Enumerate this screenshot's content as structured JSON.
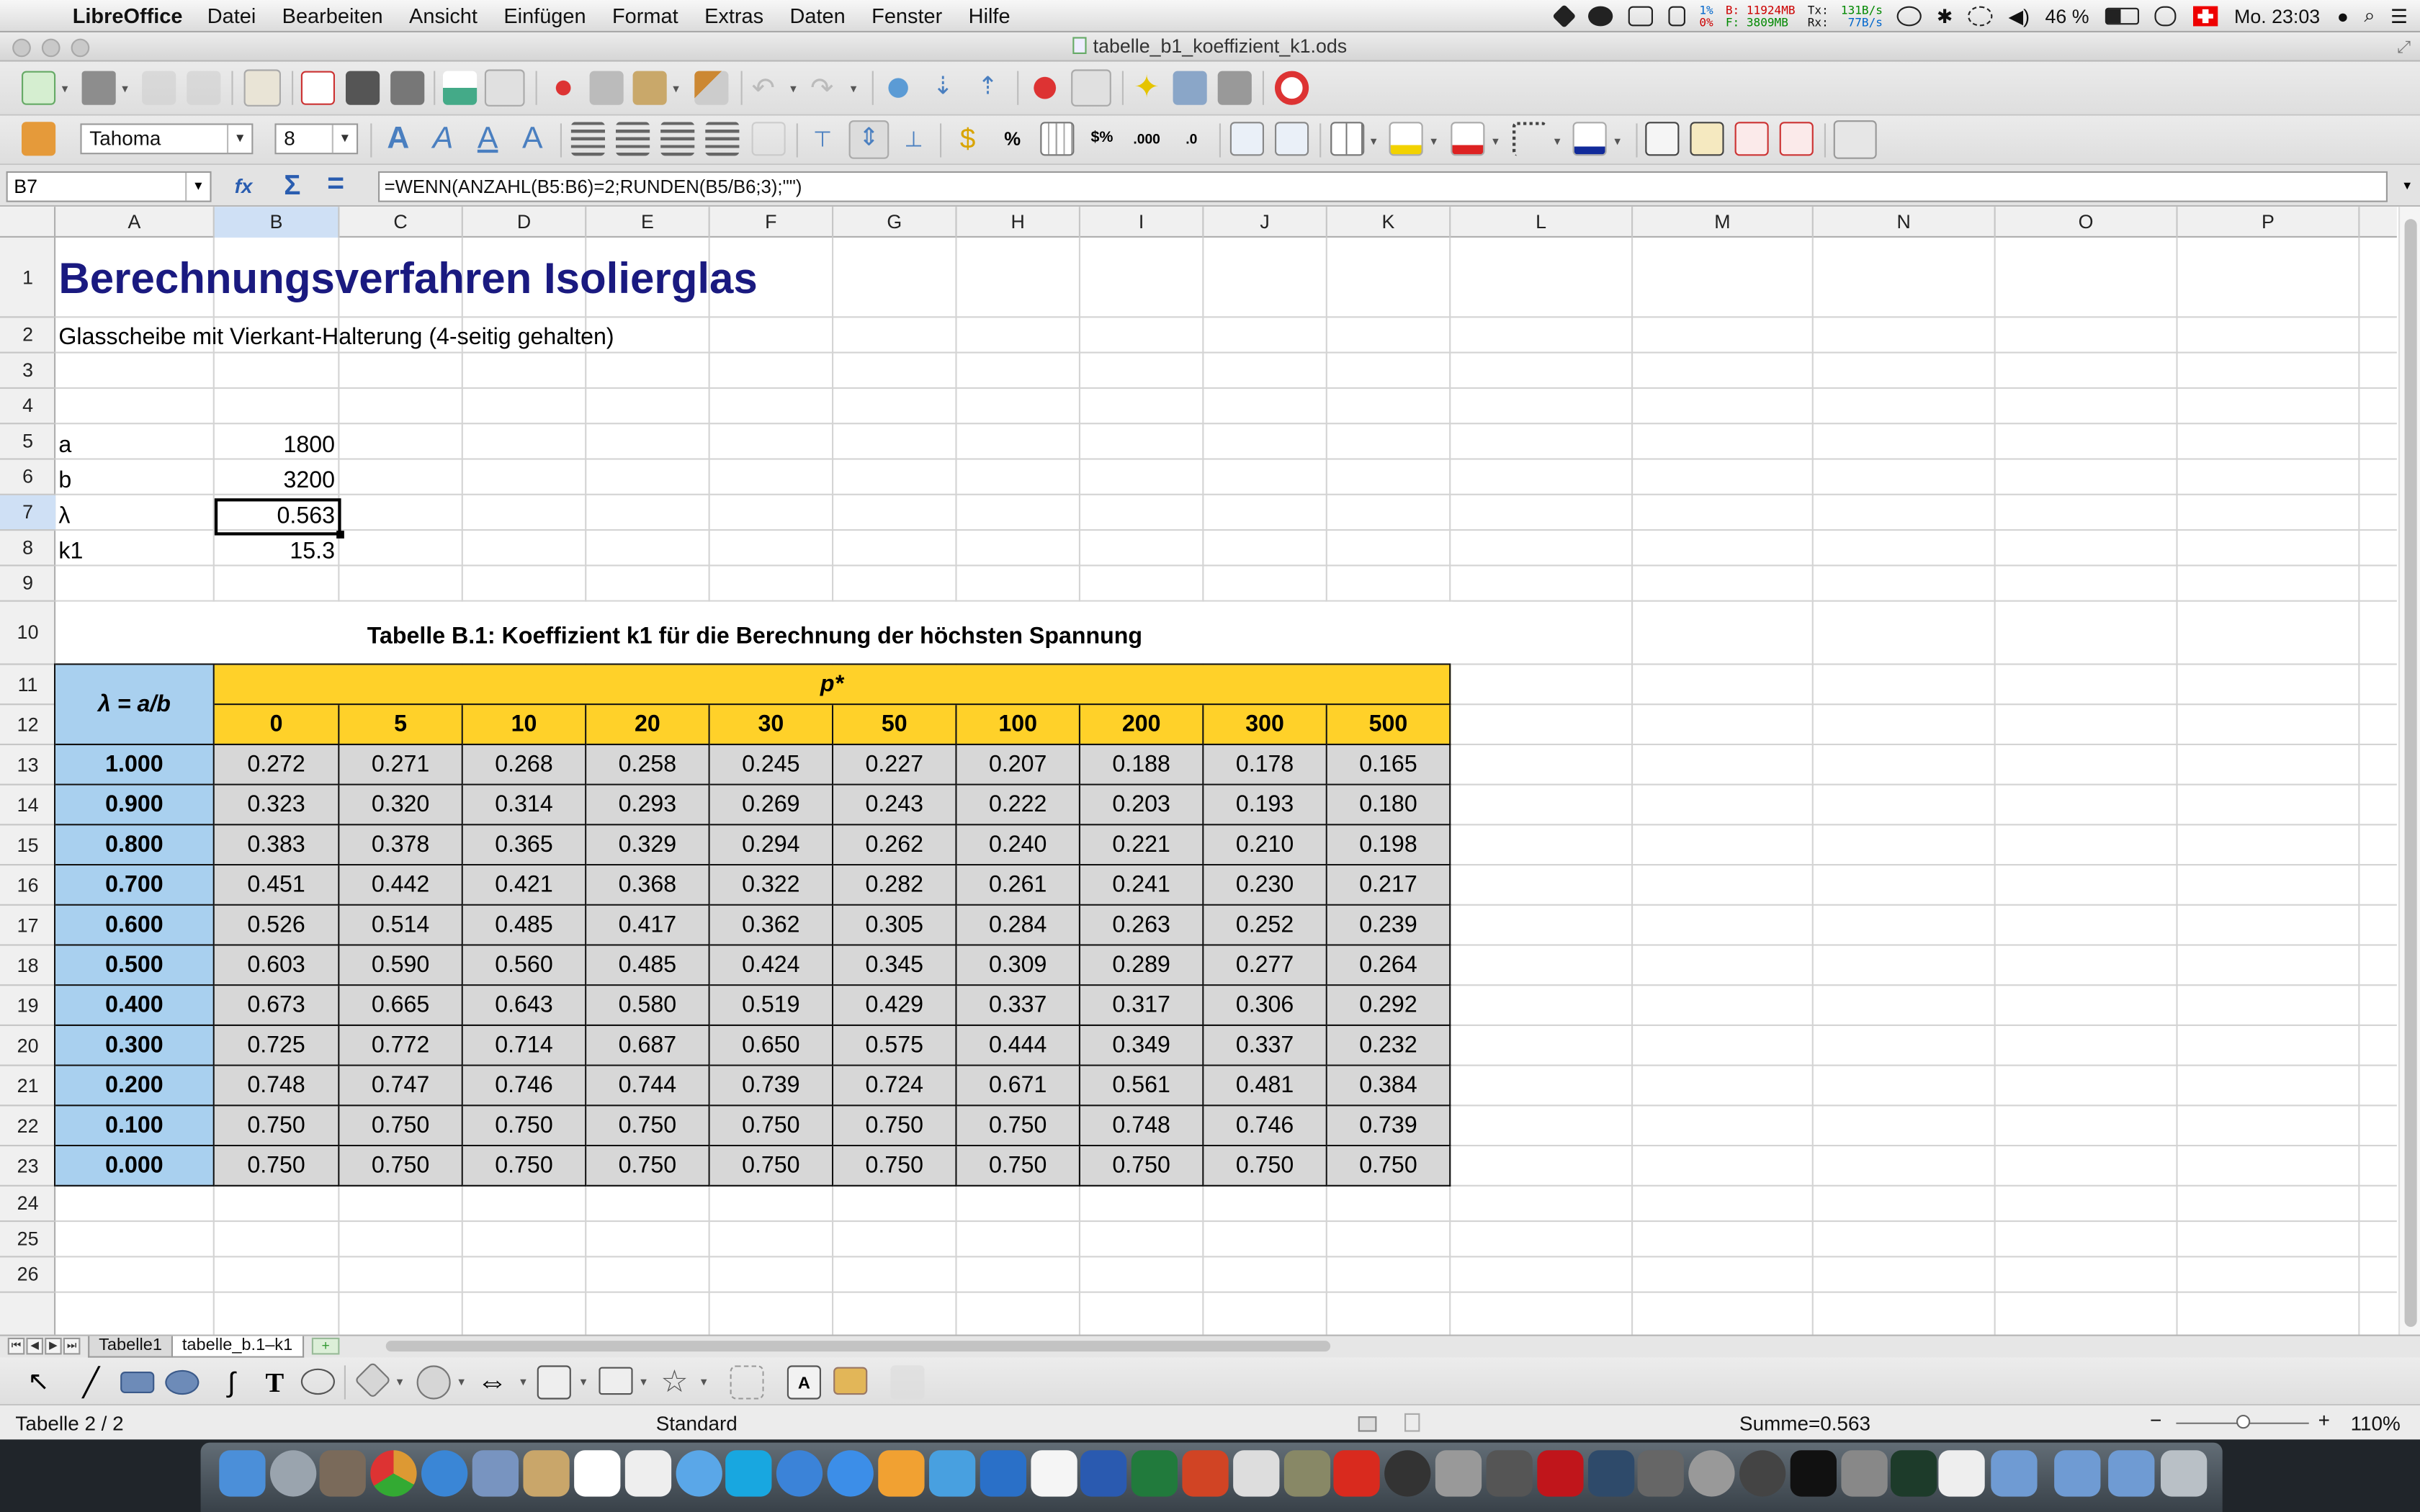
{
  "menubar": {
    "app": "LibreOffice",
    "items": [
      "Datei",
      "Bearbeiten",
      "Ansicht",
      "Einfügen",
      "Format",
      "Extras",
      "Daten",
      "Fenster",
      "Hilfe"
    ],
    "cpu": [
      "1%",
      "0%"
    ],
    "mem": [
      "B: 11924MB",
      "F:  3809MB"
    ],
    "net_labels": [
      "Tx:",
      "Rx:"
    ],
    "net_values": [
      "131B/s",
      "77B/s"
    ],
    "battery": "46 %",
    "clock": "Mo. 23:03"
  },
  "window": {
    "title": "tabelle_b1_koeffizient_k1.ods"
  },
  "format_toolbar": {
    "font_name": "Tahoma",
    "font_size": "8"
  },
  "formula_bar": {
    "cell_ref": "B7",
    "formula": "=WENN(ANZAHL(B5:B6)=2;RUNDEN(B5/B6;3);\"\")"
  },
  "columns": [
    "A",
    "B",
    "C",
    "D",
    "E",
    "F",
    "G",
    "H",
    "I",
    "J",
    "K",
    "L",
    "M",
    "N",
    "O",
    "P"
  ],
  "rows": [
    "1",
    "2",
    "3",
    "4",
    "5",
    "6",
    "7",
    "8",
    "9",
    "10",
    "11",
    "12",
    "13",
    "14",
    "15",
    "16",
    "17",
    "18",
    "19",
    "20",
    "21",
    "22",
    "23",
    "24",
    "25",
    "26"
  ],
  "sheet": {
    "title": "Berechnungsverfahren Isolierglas",
    "subtitle": "Glasscheibe mit Vierkant-Halterung (4-seitig gehalten)",
    "inputs": [
      {
        "label": "a",
        "value": "1800"
      },
      {
        "label": "b",
        "value": "3200"
      },
      {
        "label": "λ",
        "value": "0.563"
      },
      {
        "label": "k1",
        "value": "15.3"
      }
    ],
    "table_caption": "Tabelle B.1: Koeffizient k1 für die Berechnung der höchsten Spannung",
    "corner_label": "λ = a/b",
    "p_label": "p*",
    "p_values": [
      "0",
      "5",
      "10",
      "20",
      "30",
      "50",
      "100",
      "200",
      "300",
      "500"
    ],
    "lambda_values": [
      "1.000",
      "0.900",
      "0.800",
      "0.700",
      "0.600",
      "0.500",
      "0.400",
      "0.300",
      "0.200",
      "0.100",
      "0.000"
    ],
    "k1": [
      [
        "0.272",
        "0.271",
        "0.268",
        "0.258",
        "0.245",
        "0.227",
        "0.207",
        "0.188",
        "0.178",
        "0.165"
      ],
      [
        "0.323",
        "0.320",
        "0.314",
        "0.293",
        "0.269",
        "0.243",
        "0.222",
        "0.203",
        "0.193",
        "0.180"
      ],
      [
        "0.383",
        "0.378",
        "0.365",
        "0.329",
        "0.294",
        "0.262",
        "0.240",
        "0.221",
        "0.210",
        "0.198"
      ],
      [
        "0.451",
        "0.442",
        "0.421",
        "0.368",
        "0.322",
        "0.282",
        "0.261",
        "0.241",
        "0.230",
        "0.217"
      ],
      [
        "0.526",
        "0.514",
        "0.485",
        "0.417",
        "0.362",
        "0.305",
        "0.284",
        "0.263",
        "0.252",
        "0.239"
      ],
      [
        "0.603",
        "0.590",
        "0.560",
        "0.485",
        "0.424",
        "0.345",
        "0.309",
        "0.289",
        "0.277",
        "0.264"
      ],
      [
        "0.673",
        "0.665",
        "0.643",
        "0.580",
        "0.519",
        "0.429",
        "0.337",
        "0.317",
        "0.306",
        "0.292"
      ],
      [
        "0.725",
        "0.772",
        "0.714",
        "0.687",
        "0.650",
        "0.575",
        "0.444",
        "0.349",
        "0.337",
        "0.232"
      ],
      [
        "0.748",
        "0.747",
        "0.746",
        "0.744",
        "0.739",
        "0.724",
        "0.671",
        "0.561",
        "0.481",
        "0.384"
      ],
      [
        "0.750",
        "0.750",
        "0.750",
        "0.750",
        "0.750",
        "0.750",
        "0.750",
        "0.748",
        "0.746",
        "0.739"
      ],
      [
        "0.750",
        "0.750",
        "0.750",
        "0.750",
        "0.750",
        "0.750",
        "0.750",
        "0.750",
        "0.750",
        "0.750"
      ]
    ]
  },
  "tabs": [
    "Tabelle1",
    "tabelle_b.1–k1"
  ],
  "status": {
    "sheet": "Tabelle 2 / 2",
    "style": "Standard",
    "sum": "Summe=0.563",
    "zoom": "110%"
  },
  "colors": {
    "header_yellow": "#ffd129",
    "lambda_blue": "#a9d0ef",
    "data_grey": "#d7d7d7",
    "title_navy": "#1a1a80"
  }
}
